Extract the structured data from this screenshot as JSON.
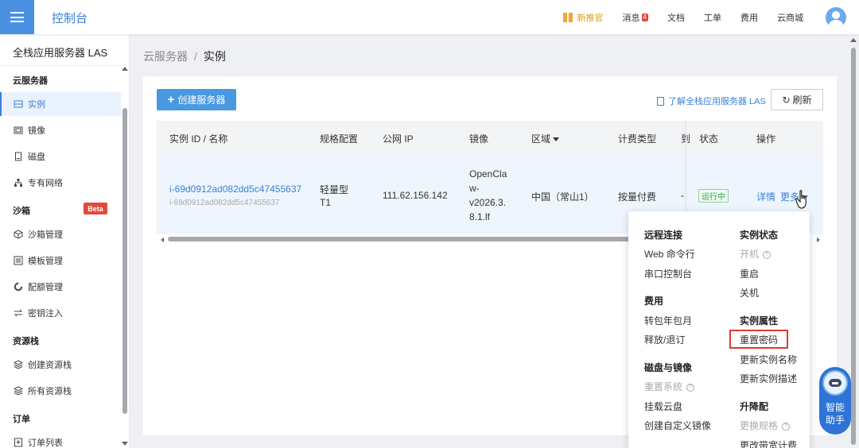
{
  "topbar": {
    "brand": "控制台",
    "nav": [
      {
        "label": "新推官",
        "promo": true
      },
      {
        "label": "消息",
        "badge": "4"
      },
      {
        "label": "文档"
      },
      {
        "label": "工单"
      },
      {
        "label": "费用"
      },
      {
        "label": "云商城"
      }
    ]
  },
  "sidebar": {
    "title": "全栈应用服务器 LAS",
    "groups": {
      "cloud_server": "云服务器",
      "sandbox": "沙箱",
      "resource_stack": "资源栈",
      "orders": "订单"
    },
    "beta": "Beta",
    "items": {
      "instances": "实例",
      "images": "镜像",
      "disks": "磁盘",
      "vpc": "专有网络",
      "sandbox_mgmt": "沙箱管理",
      "template_mgmt": "模板管理",
      "quota_mgmt": "配额管理",
      "key_injection": "密钥注入",
      "create_stack": "创建资源栈",
      "all_stacks": "所有资源栈",
      "order_list": "订单列表"
    }
  },
  "breadcrumb": {
    "parent": "云服务器",
    "separator": "/",
    "current": "实例"
  },
  "toolbar": {
    "create_label": "创建服务器",
    "learn_label": "了解全栈应用服务器 LAS",
    "refresh_label": "刷新"
  },
  "table": {
    "headers": {
      "id_name": "实例 ID / 名称",
      "spec": "规格配置",
      "public_ip": "公网 IP",
      "image": "镜像",
      "region": "区域",
      "billing": "计费类型",
      "truncated": "到",
      "status": "状态",
      "actions": "操作"
    },
    "row": {
      "id": "i-69d0912ad082dd5c47455637",
      "name": "i-69d0912ad082dd5c47455637",
      "spec_line1": "轻量型",
      "spec_line2": "T1",
      "public_ip": "111.62.156.142",
      "image_lines": [
        "OpenCla",
        "w-",
        "v2026.3.",
        "8.1.lf"
      ],
      "region": "中国（常山1）",
      "billing": "按量付费",
      "truncated": "-",
      "status": "运行中",
      "detail": "详情",
      "more": "更多"
    }
  },
  "dropdown": {
    "remote": {
      "heading": "远程连接",
      "items": [
        "Web 命令行",
        "串口控制台"
      ]
    },
    "fees": {
      "heading": "费用",
      "items": [
        "转包年包月",
        "释放/退订"
      ]
    },
    "disk_image": {
      "heading": "磁盘与镜像",
      "items": [
        "重置系统",
        "挂载云盘",
        "创建自定义镜像"
      ]
    },
    "state": {
      "heading": "实例状态",
      "items": [
        "开机",
        "重启",
        "关机"
      ]
    },
    "attrs": {
      "heading": "实例属性",
      "items": [
        "重置密码",
        "更新实例名称",
        "更新实例描述"
      ]
    },
    "upgrade": {
      "heading": "升降配",
      "items": [
        "更换规格",
        "更改带宽计费"
      ]
    }
  },
  "assistant": {
    "line1": "智能",
    "line2": "助手"
  },
  "colors": {
    "accent": "#3b82d6",
    "primary_button": "#4a98e0",
    "status_green": "#2ca74a",
    "beta_red": "#e04a3c",
    "highlight_red": "#e03a2f"
  }
}
